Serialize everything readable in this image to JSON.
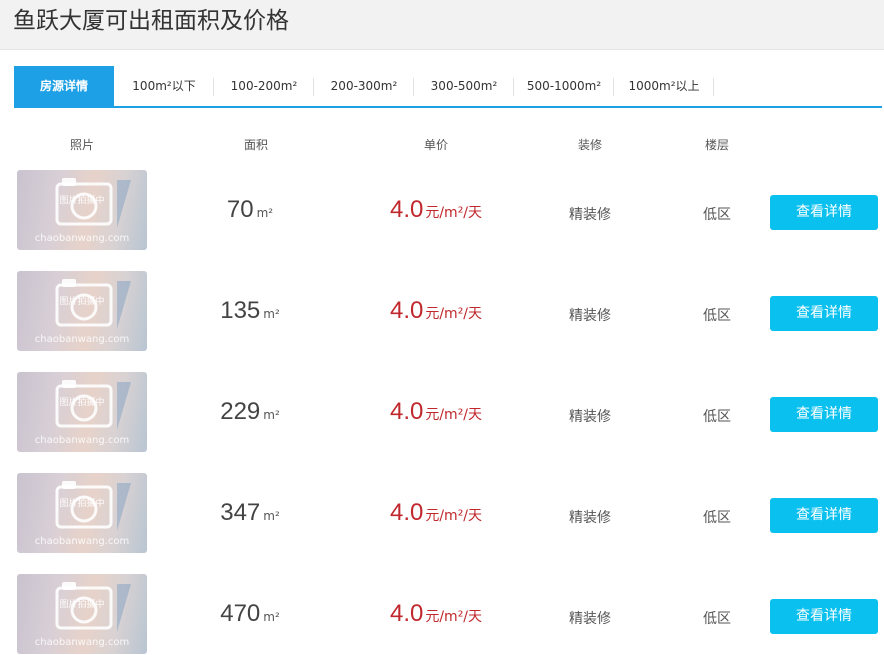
{
  "page": {
    "title": "鱼跃大厦可出租面积及价格"
  },
  "tabs": [
    {
      "label": "房源详情",
      "active": true
    },
    {
      "label": "100m²以下"
    },
    {
      "label": "100-200m²"
    },
    {
      "label": "200-300m²"
    },
    {
      "label": "300-500m²"
    },
    {
      "label": "500-1000m²"
    },
    {
      "label": "1000m²以上"
    }
  ],
  "columns": [
    "照片",
    "面积",
    "单价",
    "装修",
    "楼层"
  ],
  "photo": {
    "overlay": "图片拍摄中",
    "watermark": "chaobanwang.com"
  },
  "listings": [
    {
      "area": "70",
      "area_unit": "m²",
      "price": "4.0",
      "price_unit": "元/m²/天",
      "decoration": "精装修",
      "floor": "低区",
      "button": "查看详情"
    },
    {
      "area": "135",
      "area_unit": "m²",
      "price": "4.0",
      "price_unit": "元/m²/天",
      "decoration": "精装修",
      "floor": "低区",
      "button": "查看详情"
    },
    {
      "area": "229",
      "area_unit": "m²",
      "price": "4.0",
      "price_unit": "元/m²/天",
      "decoration": "精装修",
      "floor": "低区",
      "button": "查看详情"
    },
    {
      "area": "347",
      "area_unit": "m²",
      "price": "4.0",
      "price_unit": "元/m²/天",
      "decoration": "精装修",
      "floor": "低区",
      "button": "查看详情"
    },
    {
      "area": "470",
      "area_unit": "m²",
      "price": "4.0",
      "price_unit": "元/m²/天",
      "decoration": "精装修",
      "floor": "低区",
      "button": "查看详情"
    }
  ],
  "colors": {
    "accent": "#1ea0e6",
    "button": "#0ac0ee",
    "price": "#c0282d"
  }
}
